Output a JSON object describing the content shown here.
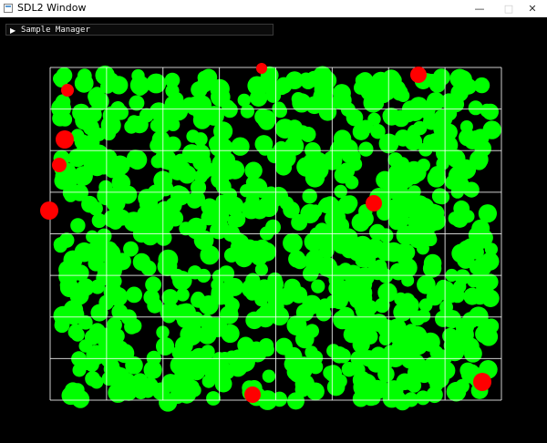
{
  "window": {
    "title": "SDL2 Window",
    "controls": {
      "minimize": "—",
      "maximize": "□",
      "close": "✕"
    },
    "icon": "sdl-window-icon"
  },
  "panel": {
    "title": "Sample Manager",
    "expand_icon": "triangle-right-icon",
    "expanded": false
  },
  "colors": {
    "background": "#000000",
    "grid": "#ffffff",
    "sample": "#00ff00",
    "rejected": "#ff0000"
  },
  "grid": {
    "columns": 8,
    "rows": 8
  }
}
